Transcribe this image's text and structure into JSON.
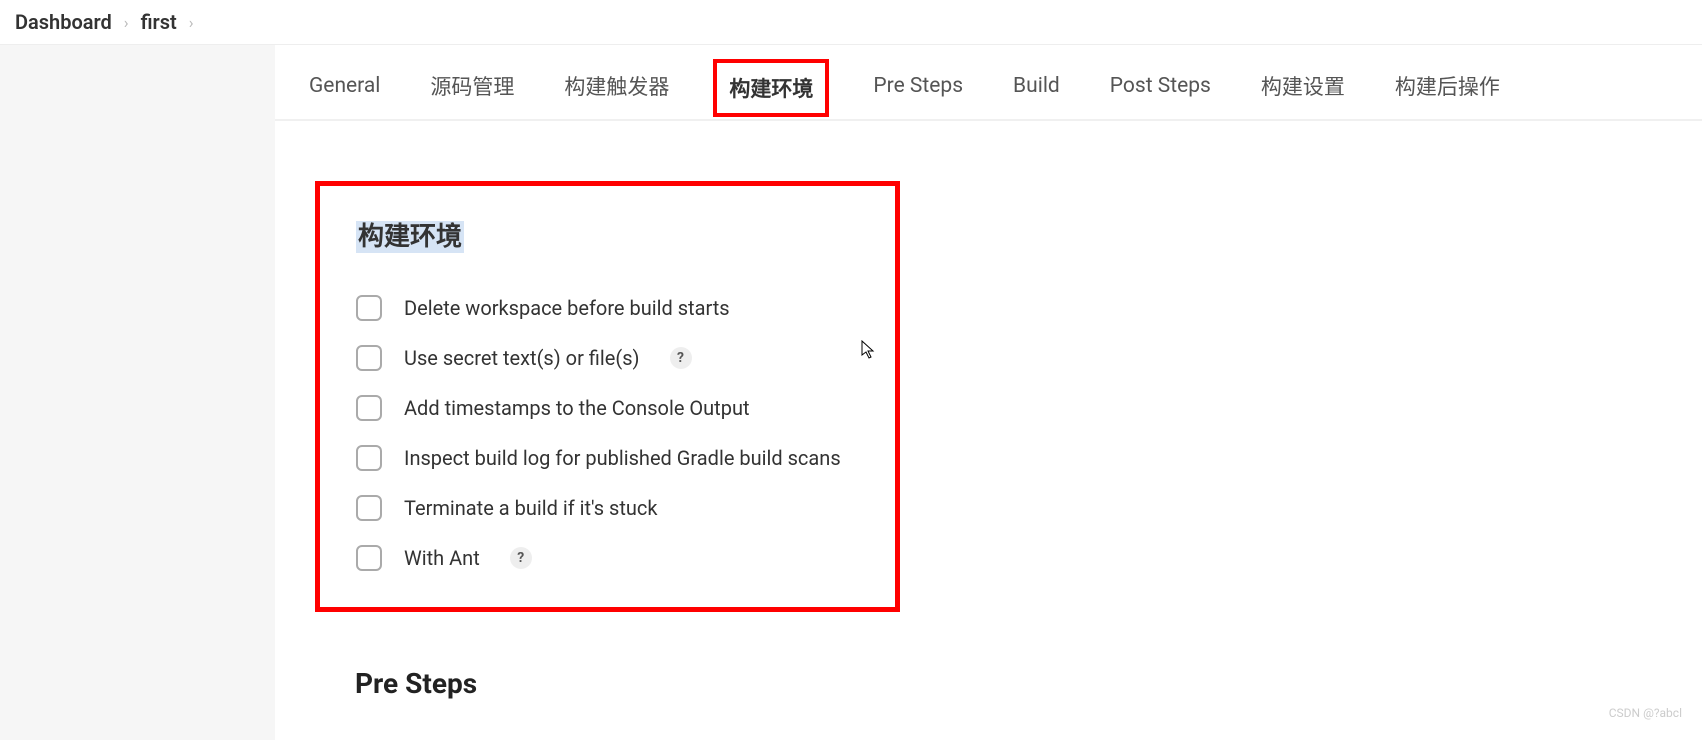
{
  "breadcrumb": {
    "items": [
      "Dashboard",
      "first"
    ]
  },
  "tabs": [
    {
      "label": "General",
      "active": false
    },
    {
      "label": "源码管理",
      "active": false
    },
    {
      "label": "构建触发器",
      "active": false
    },
    {
      "label": "构建环境",
      "active": true
    },
    {
      "label": "Pre Steps",
      "active": false
    },
    {
      "label": "Build",
      "active": false
    },
    {
      "label": "Post Steps",
      "active": false
    },
    {
      "label": "构建设置",
      "active": false
    },
    {
      "label": "构建后操作",
      "active": false
    }
  ],
  "section": {
    "title": "构建环境",
    "options": [
      {
        "label": "Delete workspace before build starts",
        "help": false
      },
      {
        "label": "Use secret text(s) or file(s)",
        "help": true
      },
      {
        "label": "Add timestamps to the Console Output",
        "help": false
      },
      {
        "label": "Inspect build log for published Gradle build scans",
        "help": false
      },
      {
        "label": "Terminate a build if it's stuck",
        "help": false
      },
      {
        "label": "With Ant",
        "help": true
      }
    ]
  },
  "next_section": {
    "title": "Pre Steps"
  },
  "help_symbol": "?",
  "watermark": "CSDN @?abcl"
}
